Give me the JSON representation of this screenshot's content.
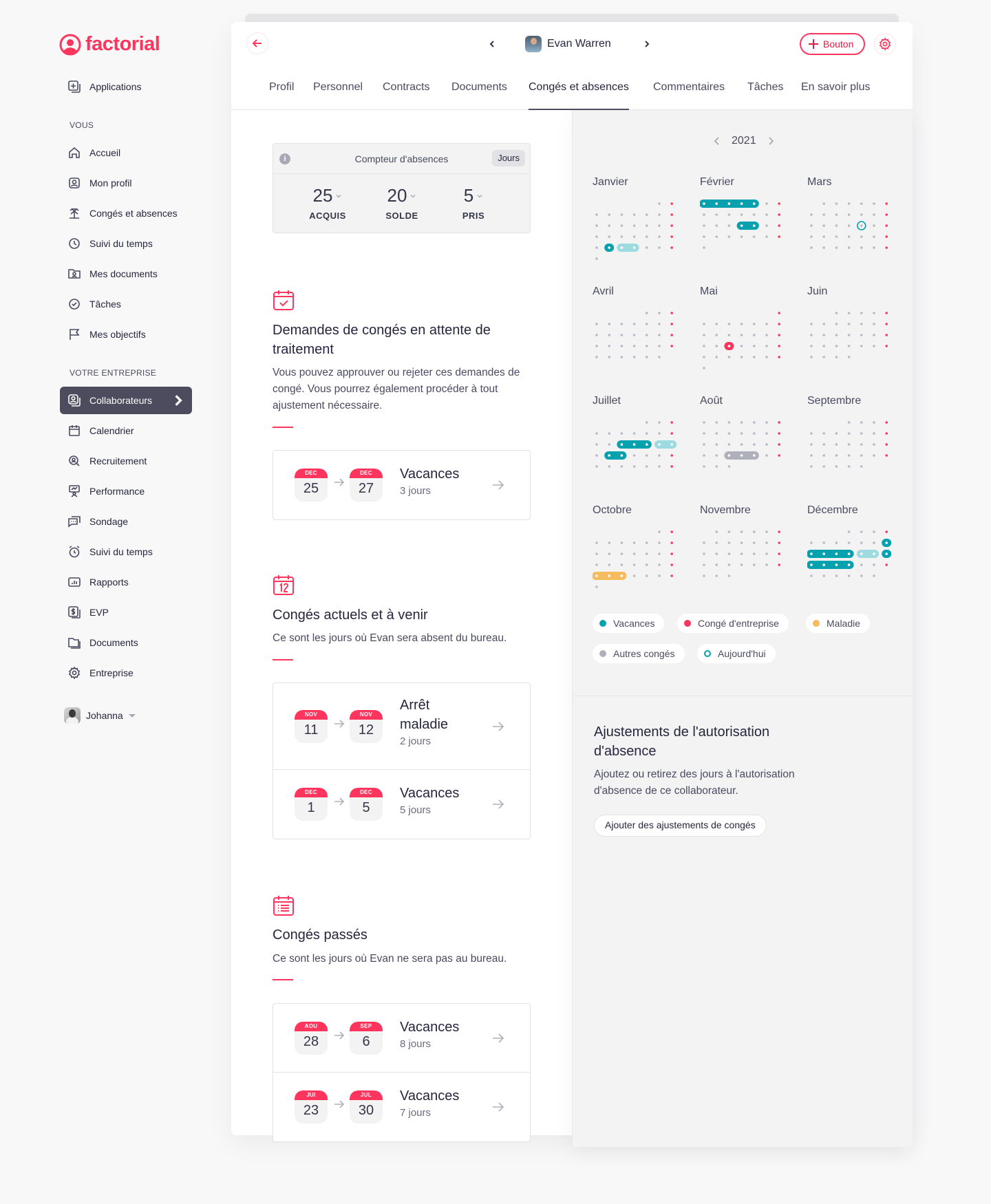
{
  "brand": {
    "name": "factorial",
    "color": "#ff355e"
  },
  "sidebar": {
    "applications": "Applications",
    "section_you": "VOUS",
    "you_items": [
      {
        "label": "Accueil",
        "icon": "home-icon"
      },
      {
        "label": "Mon profil",
        "icon": "profile-icon"
      },
      {
        "label": "Congés et absences",
        "icon": "palm-tree-icon"
      },
      {
        "label": "Suivi du temps",
        "icon": "clock-icon"
      },
      {
        "label": "Mes documents",
        "icon": "folder-user-icon"
      },
      {
        "label": "Tâches",
        "icon": "check-circle-icon"
      },
      {
        "label": "Mes objectifs",
        "icon": "flag-icon"
      }
    ],
    "section_company": "VOTRE ENTREPRISE",
    "company_items": [
      {
        "label": "Collaborateurs",
        "icon": "users-icon",
        "active": true
      },
      {
        "label": "Calendrier",
        "icon": "calendar-icon"
      },
      {
        "label": "Recruitement",
        "icon": "recruitment-icon"
      },
      {
        "label": "Performance",
        "icon": "performance-icon"
      },
      {
        "label": "Sondage",
        "icon": "survey-icon"
      },
      {
        "label": "Suivi du temps",
        "icon": "stopwatch-icon"
      },
      {
        "label": "Rapports",
        "icon": "reports-icon"
      },
      {
        "label": "EVP",
        "icon": "dollar-icon"
      },
      {
        "label": "Documents",
        "icon": "folder-icon"
      },
      {
        "label": "Entreprise",
        "icon": "gear-icon"
      }
    ],
    "user": {
      "name": "Johanna"
    }
  },
  "header": {
    "employee_name": "Evan Warren",
    "action_button": "Bouton",
    "tabs": [
      {
        "label": "Profil"
      },
      {
        "label": "Personnel"
      },
      {
        "label": "Contracts"
      },
      {
        "label": "Documents"
      },
      {
        "label": "Congés et absences",
        "active": true
      },
      {
        "label": "Commentaires"
      },
      {
        "label": "Tâches"
      },
      {
        "label": "En savoir plus"
      }
    ]
  },
  "counter": {
    "title": "Compteur d'absences",
    "unit": "Jours",
    "stats": [
      {
        "value": "25",
        "label": "ACQUIS"
      },
      {
        "value": "20",
        "label": "SOLDE"
      },
      {
        "value": "5",
        "label": "PRIS"
      }
    ]
  },
  "sections": {
    "pending": {
      "title": "Demandes de congés en attente de traitement",
      "description": "Vous pouvez approuver ou rejeter ces demandes de congé. Vous pourrez également procéder à tout ajustement nécessaire.",
      "items": [
        {
          "from_month": "DEC",
          "from_day": "25",
          "to_month": "DEC",
          "to_day": "27",
          "type": "Vacances",
          "days": "3 jours"
        }
      ]
    },
    "upcoming": {
      "title": "Congés actuels et à venir",
      "description": "Ce sont les jours où Evan sera absent du bureau.",
      "items": [
        {
          "from_month": "NOV",
          "from_day": "11",
          "to_month": "NOV",
          "to_day": "12",
          "type": "Arrêt maladie",
          "days": "2 jours"
        },
        {
          "from_month": "DEC",
          "from_day": "1",
          "to_month": "DEC",
          "to_day": "5",
          "type": "Vacances",
          "days": "5 jours"
        }
      ]
    },
    "past": {
      "title": "Congés passés",
      "description": "Ce sont les jours où Evan ne sera pas au bureau.",
      "items": [
        {
          "from_month": "AOU",
          "from_day": "28",
          "to_month": "SEP",
          "to_day": "6",
          "type": "Vacances",
          "days": "8 jours"
        },
        {
          "from_month": "JUI",
          "from_day": "23",
          "to_month": "JUL",
          "to_day": "30",
          "type": "Vacances",
          "days": "7 jours"
        }
      ]
    }
  },
  "calendar": {
    "year": "2021",
    "colors": {
      "vacation": "#06a1ae",
      "vacation_pending": "#9edbe0",
      "company": "#ff355e",
      "sick": "#f5bb5c",
      "other": "#b0b0bc",
      "day": "#b9b9c4"
    },
    "months": [
      {
        "name": "Janvier",
        "start": 5,
        "days": 31,
        "ranges": [
          {
            "from": 25,
            "to": 25,
            "kind": "vacation"
          },
          {
            "from": 26,
            "to": 27,
            "kind": "vacation_pending"
          }
        ]
      },
      {
        "name": "Février",
        "start": 0,
        "days": 29,
        "ranges": [
          {
            "from": 1,
            "to": 5,
            "kind": "vacation"
          },
          {
            "from": 18,
            "to": 19,
            "kind": "vacation"
          }
        ]
      },
      {
        "name": "Mars",
        "start": 1,
        "days": 34,
        "ranges": [],
        "today": 18
      },
      {
        "name": "Avril",
        "start": 4,
        "days": 30,
        "ranges": []
      },
      {
        "name": "Mai",
        "start": 6,
        "days": 30,
        "ranges": [
          {
            "from": 18,
            "to": 18,
            "kind": "company"
          }
        ]
      },
      {
        "name": "Juin",
        "start": 2,
        "days": 30,
        "ranges": []
      },
      {
        "name": "Juillet",
        "start": 4,
        "days": 31,
        "ranges": [
          {
            "from": 13,
            "to": 15,
            "kind": "vacation"
          },
          {
            "from": 16,
            "to": 17,
            "kind": "vacation_pending"
          },
          {
            "from": 19,
            "to": 20,
            "kind": "vacation"
          }
        ]
      },
      {
        "name": "Août",
        "start": 0,
        "days": 31,
        "ranges": [
          {
            "from": 24,
            "to": 26,
            "kind": "other"
          }
        ]
      },
      {
        "name": "Septembre",
        "start": 3,
        "days": 30,
        "ranges": []
      },
      {
        "name": "Octobre",
        "start": 5,
        "days": 31,
        "ranges": [
          {
            "from": 24,
            "to": 26,
            "kind": "sick"
          }
        ]
      },
      {
        "name": "Novembre",
        "start": 1,
        "days": 30,
        "ranges": []
      },
      {
        "name": "Décembre",
        "start": 3,
        "days": 31,
        "ranges": [
          {
            "from": 11,
            "to": 15,
            "kind": "vacation"
          },
          {
            "from": 16,
            "to": 17,
            "kind": "vacation_pending"
          },
          {
            "from": 18,
            "to": 22,
            "kind": "vacation"
          }
        ]
      }
    ],
    "legend": [
      {
        "label": "Vacances",
        "color": "#06a1ae"
      },
      {
        "label": "Congé d'entreprise",
        "color": "#ff355e"
      },
      {
        "label": "Maladie",
        "color": "#f5bb5c"
      },
      {
        "label": "Autres congés",
        "color": "#b0b0bc"
      },
      {
        "label": "Aujourd'hui",
        "color": "#06a1ae",
        "ring": true
      }
    ]
  },
  "adjustments": {
    "title": "Ajustements de l'autorisation d'absence",
    "description": "Ajoutez ou retirez des jours à l'autorisation d'absence de ce collaborateur.",
    "button": "Ajouter des ajustements de congés"
  }
}
